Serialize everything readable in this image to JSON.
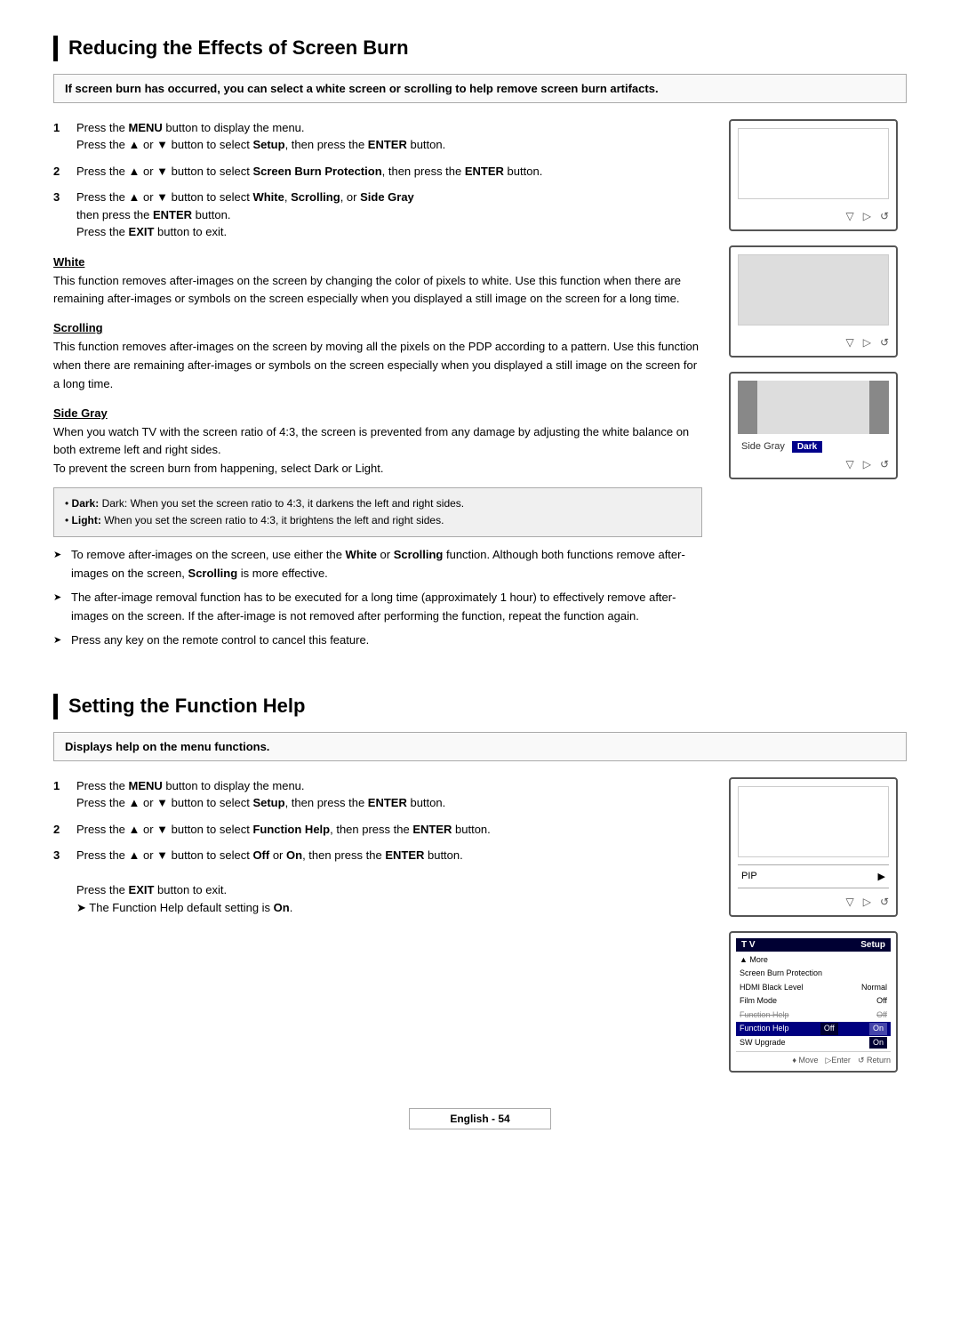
{
  "page": {
    "footer": "English - 54"
  },
  "section1": {
    "title": "Reducing the Effects of Screen Burn",
    "subtitle": "If screen burn has occurred, you can select a white screen or scrolling to help remove screen burn artifacts.",
    "steps": [
      {
        "num": "1",
        "text": "Press the MENU button to display the menu.\nPress the ▲ or ▼ button to select Setup, then press the ENTER button."
      },
      {
        "num": "2",
        "text": "Press the ▲ or ▼ button to select Screen Burn Protection, then press the ENTER button."
      },
      {
        "num": "3",
        "text": "Press the ▲ or ▼ button to select White, Scrolling, or Side Gray\nthen press the ENTER button.\nPress the EXIT button to exit."
      }
    ],
    "white_heading": "White",
    "white_text": "This function removes after-images on the screen by changing the color of pixels to white. Use this function when there are remaining after-images or symbols on the screen especially when you displayed a still image on the screen for a long time.",
    "scrolling_heading": "Scrolling",
    "scrolling_text": "This function removes after-images on the screen by moving all the pixels on the PDP according to a pattern. Use this function when there are remaining after-images or symbols on the screen especially when you displayed a still image on the screen for a long time.",
    "sidegray_heading": "Side Gray",
    "sidegray_text": "When you watch TV with the screen ratio of 4:3, the screen is prevented from any damage by adjusting the white balance on both extreme left and right sides.\nTo prevent the screen burn from happening, select Dark or Light.",
    "note_dark": "Dark: When you set the screen ratio to 4:3, it darkens the left and right sides.",
    "note_light": "Light: When you set the screen ratio to 4:3, it brightens the left and right sides.",
    "arrows": [
      "To remove after-images on the screen, use either the White or Scrolling function. Although both functions remove after-images on the screen, Scrolling is more effective.",
      "The after-image removal function has to be executed for a long time (approximately 1 hour) to effectively remove after-images on the screen. If the after-image is not removed after performing the function, repeat the function again.",
      "Press any key on the remote control to cancel this feature."
    ],
    "sidegray_label": "Side Gray",
    "sidegray_value": "Dark"
  },
  "section2": {
    "title": "Setting the Function Help",
    "subtitle": "Displays help on the menu functions.",
    "steps": [
      {
        "num": "1",
        "text": "Press the MENU button to display the menu.\nPress the ▲ or ▼ button to select Setup, then press the ENTER button."
      },
      {
        "num": "2",
        "text": "Press the ▲ or ▼ button to select Function Help, then press the ENTER button."
      },
      {
        "num": "3",
        "text": "Press the ▲ or ▼ button to select Off or On, then press the ENTER button.\nPress the EXIT button to exit."
      }
    ],
    "default_note": "➤  The Function Help default setting is On.",
    "pip_label": "PIP",
    "menu_title_left": "T V",
    "menu_title_right": "Setup",
    "menu_items": [
      {
        "label": "▲ More",
        "value": ""
      },
      {
        "label": "Screen Burn Protection",
        "value": ""
      },
      {
        "label": "HDMI Black Level",
        "value": "Normal"
      },
      {
        "label": "Film Mode",
        "value": "Off"
      },
      {
        "label": "Function Help",
        "value": "Off",
        "highlighted": false
      },
      {
        "label": "Function Help",
        "value": "Off",
        "highlighted": true
      },
      {
        "label": "SW Upgrade",
        "value": "On",
        "highlighted": false
      }
    ],
    "menu_nav": "♦ Move  ▷Enter  ↺ Return"
  }
}
